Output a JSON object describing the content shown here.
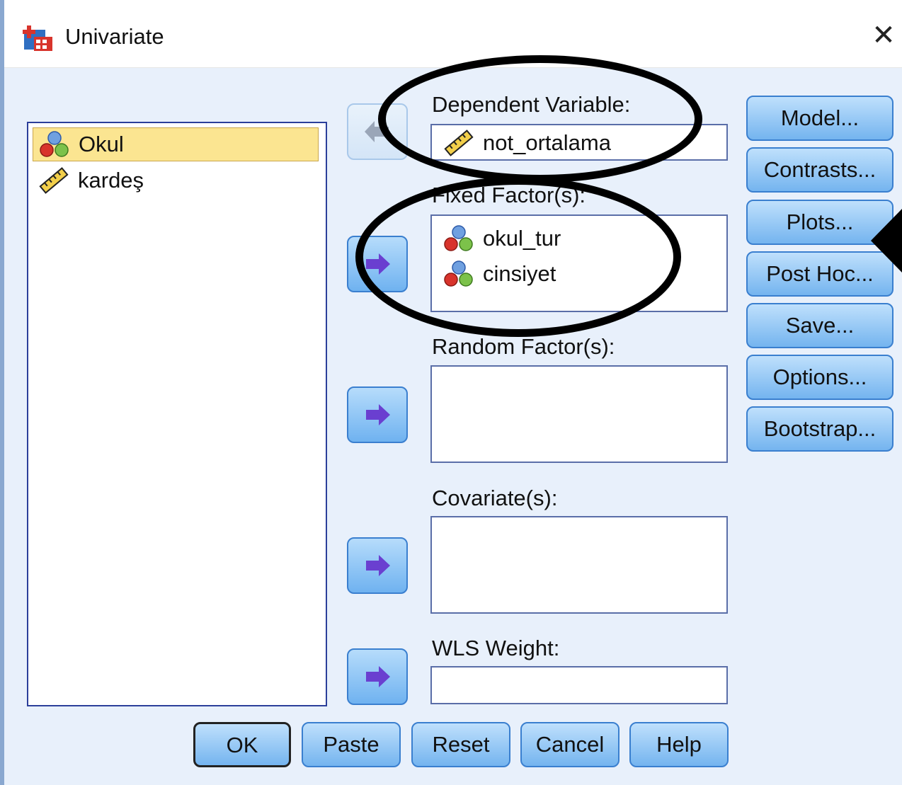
{
  "window": {
    "title": "Univariate",
    "close_glyph": "✕"
  },
  "variable_list": {
    "items": [
      {
        "label": "Okul",
        "icon": "nominal-icon",
        "selected": true
      },
      {
        "label": "kardeş",
        "icon": "scale-icon",
        "selected": false
      }
    ]
  },
  "dependent_variable": {
    "label": "Dependent Variable:",
    "value": "not_ortalama",
    "icon": "scale-icon"
  },
  "fixed_factors": {
    "label": "Fixed Factor(s):",
    "items": [
      "okul_tur",
      "cinsiyet"
    ],
    "icon": "nominal-icon"
  },
  "random_factors": {
    "label": "Random Factor(s):"
  },
  "covariates": {
    "label": "Covariate(s):"
  },
  "wls_weight": {
    "label": "WLS Weight:"
  },
  "side_buttons": {
    "model": "Model...",
    "contrasts": "Contrasts...",
    "plots": "Plots...",
    "post_hoc": "Post Hoc...",
    "save": "Save...",
    "options": "Options...",
    "bootstrap": "Bootstrap..."
  },
  "bottom_buttons": {
    "ok": "OK",
    "paste": "Paste",
    "reset": "Reset",
    "cancel": "Cancel",
    "help": "Help"
  },
  "colors": {
    "selection": "#fbe591",
    "button": "#74b4ef",
    "annotation": "#000000"
  }
}
